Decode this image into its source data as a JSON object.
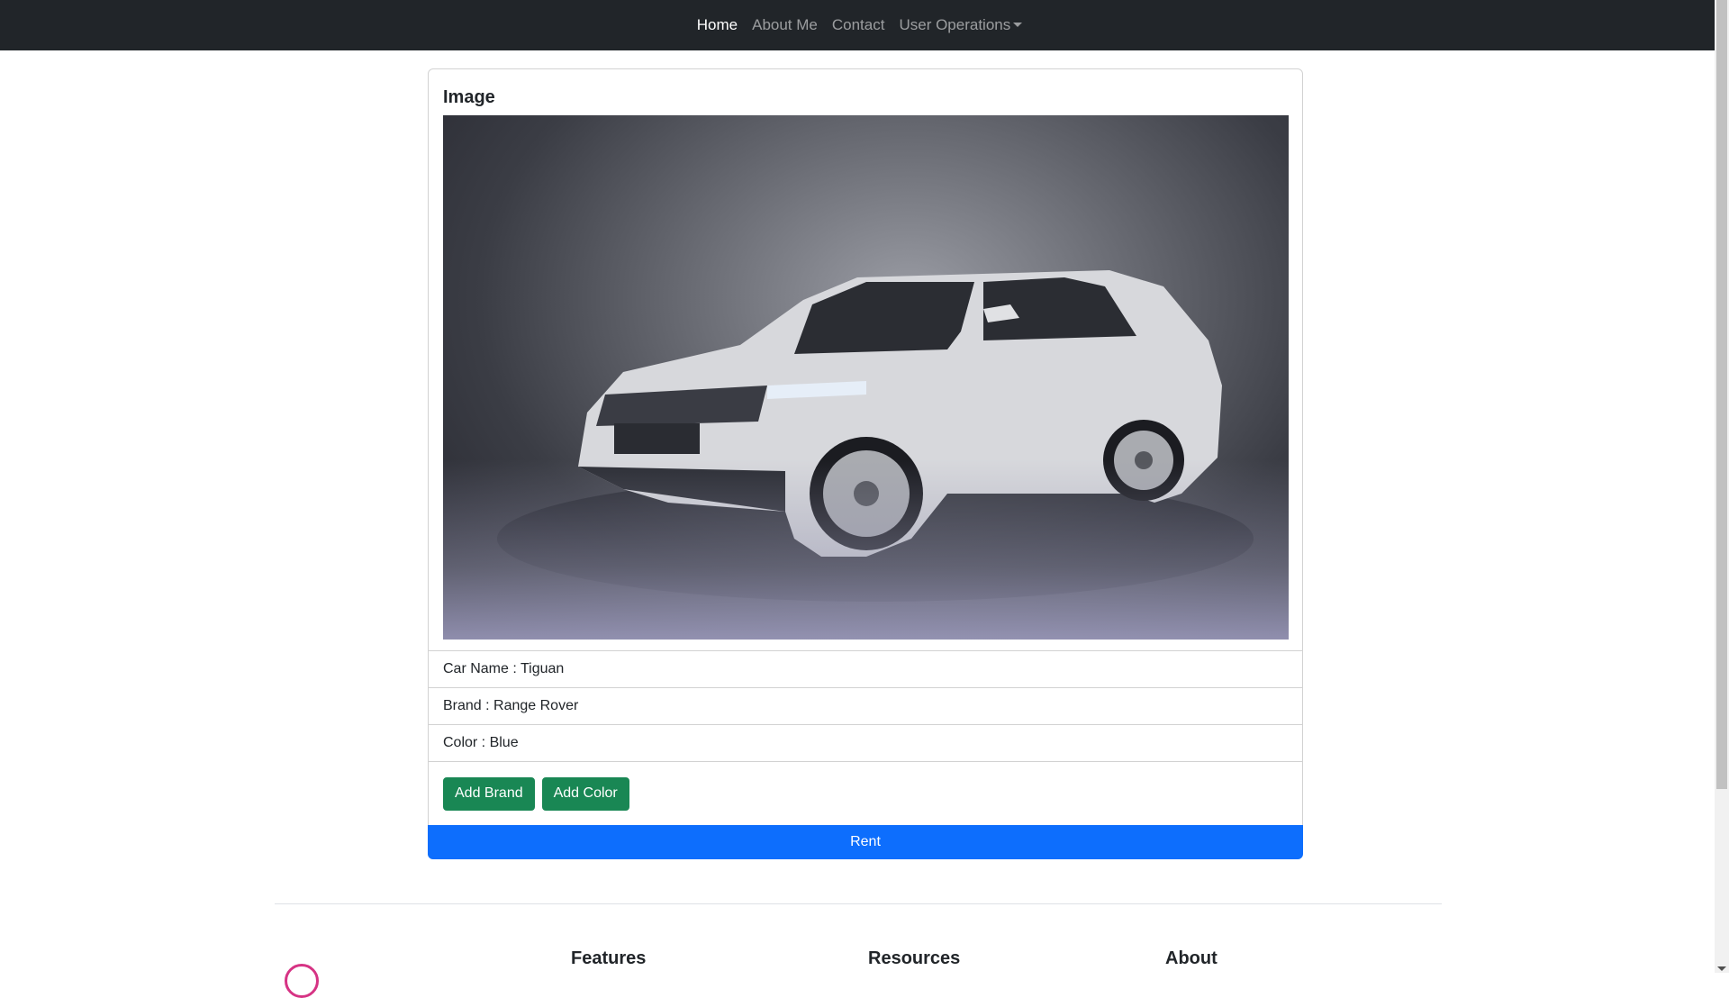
{
  "navbar": {
    "items": [
      {
        "label": "Home",
        "active": true
      },
      {
        "label": "About Me",
        "active": false
      },
      {
        "label": "Contact",
        "active": false
      },
      {
        "label": "User Operations",
        "active": false,
        "dropdown": true
      }
    ]
  },
  "card": {
    "title": "Image",
    "image_icon": "car-photo",
    "car_name": "Car Name : Tiguan",
    "brand": "Brand : Range Rover",
    "color": "Color : Blue",
    "buttons": {
      "add_brand": "Add Brand",
      "add_color": "Add Color"
    },
    "rent": "Rent"
  },
  "footer": {
    "headings": [
      "Features",
      "Resources",
      "About"
    ],
    "logo_icon": "logo-icon"
  },
  "colors": {
    "navbar_bg": "#212529",
    "success": "#198754",
    "primary": "#0d6efd"
  }
}
